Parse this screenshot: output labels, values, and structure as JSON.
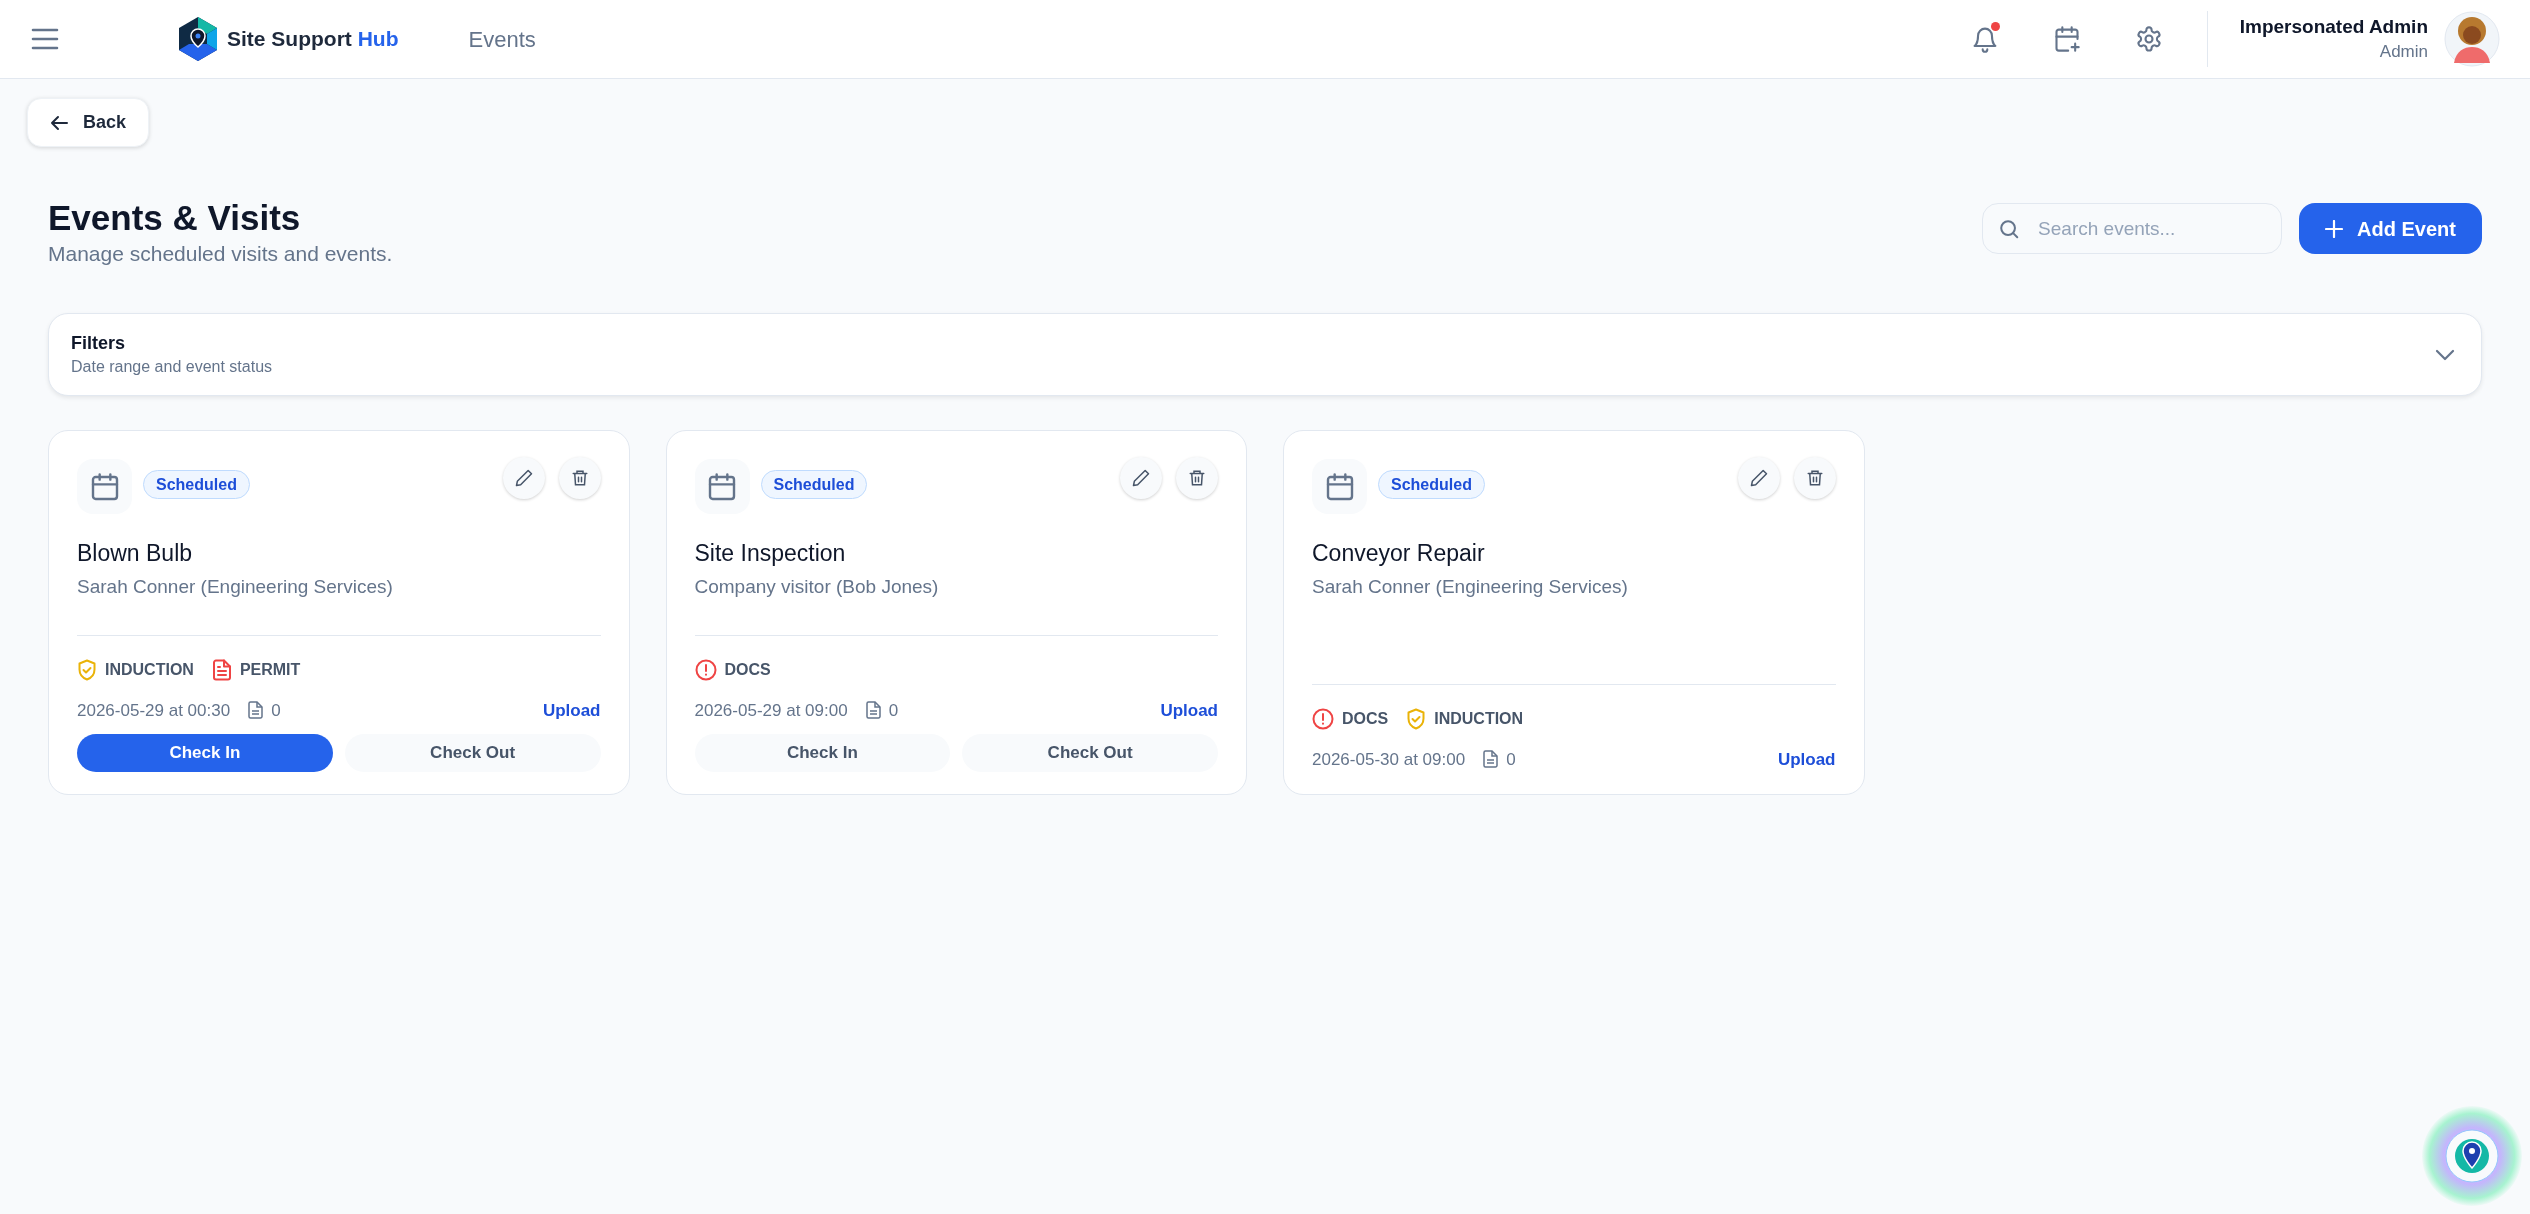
{
  "header": {
    "brand": "Site Support",
    "brand_accent": "Hub",
    "page": "Events",
    "notifications_unread": true,
    "user_name": "Impersonated Admin",
    "user_role": "Admin"
  },
  "back": "Back",
  "title": "Events & Visits",
  "subtitle": "Manage scheduled visits and events.",
  "search": {
    "placeholder": "Search events..."
  },
  "add_button": "Add Event",
  "filters": {
    "title": "Filters",
    "subtitle": "Date range and event status",
    "expanded": false
  },
  "events": [
    {
      "status": "Scheduled",
      "title": "Blown Bulb",
      "person": "Sarah Conner (Engineering Services)",
      "tags": [
        {
          "kind": "induction",
          "label": "INDUCTION"
        },
        {
          "kind": "permit",
          "label": "PERMIT"
        }
      ],
      "when": "2026-05-29 at 00:30",
      "docs": "0",
      "upload": "Upload",
      "actions": [
        {
          "label": "Check In",
          "primary": true
        },
        {
          "label": "Check Out",
          "primary": false
        }
      ]
    },
    {
      "status": "Scheduled",
      "title": "Site Inspection",
      "person": "Company visitor (Bob Jones)",
      "tags": [
        {
          "kind": "docs",
          "label": "DOCS"
        }
      ],
      "when": "2026-05-29 at 09:00",
      "docs": "0",
      "upload": "Upload",
      "actions": [
        {
          "label": "Check In",
          "primary": false
        },
        {
          "label": "Check Out",
          "primary": false
        }
      ]
    },
    {
      "status": "Scheduled",
      "title": "Conveyor Repair",
      "person": "Sarah Conner (Engineering Services)",
      "tags": [
        {
          "kind": "docs",
          "label": "DOCS"
        },
        {
          "kind": "induction",
          "label": "INDUCTION"
        }
      ],
      "when": "2026-05-30 at 09:00",
      "docs": "0",
      "upload": "Upload"
    }
  ]
}
